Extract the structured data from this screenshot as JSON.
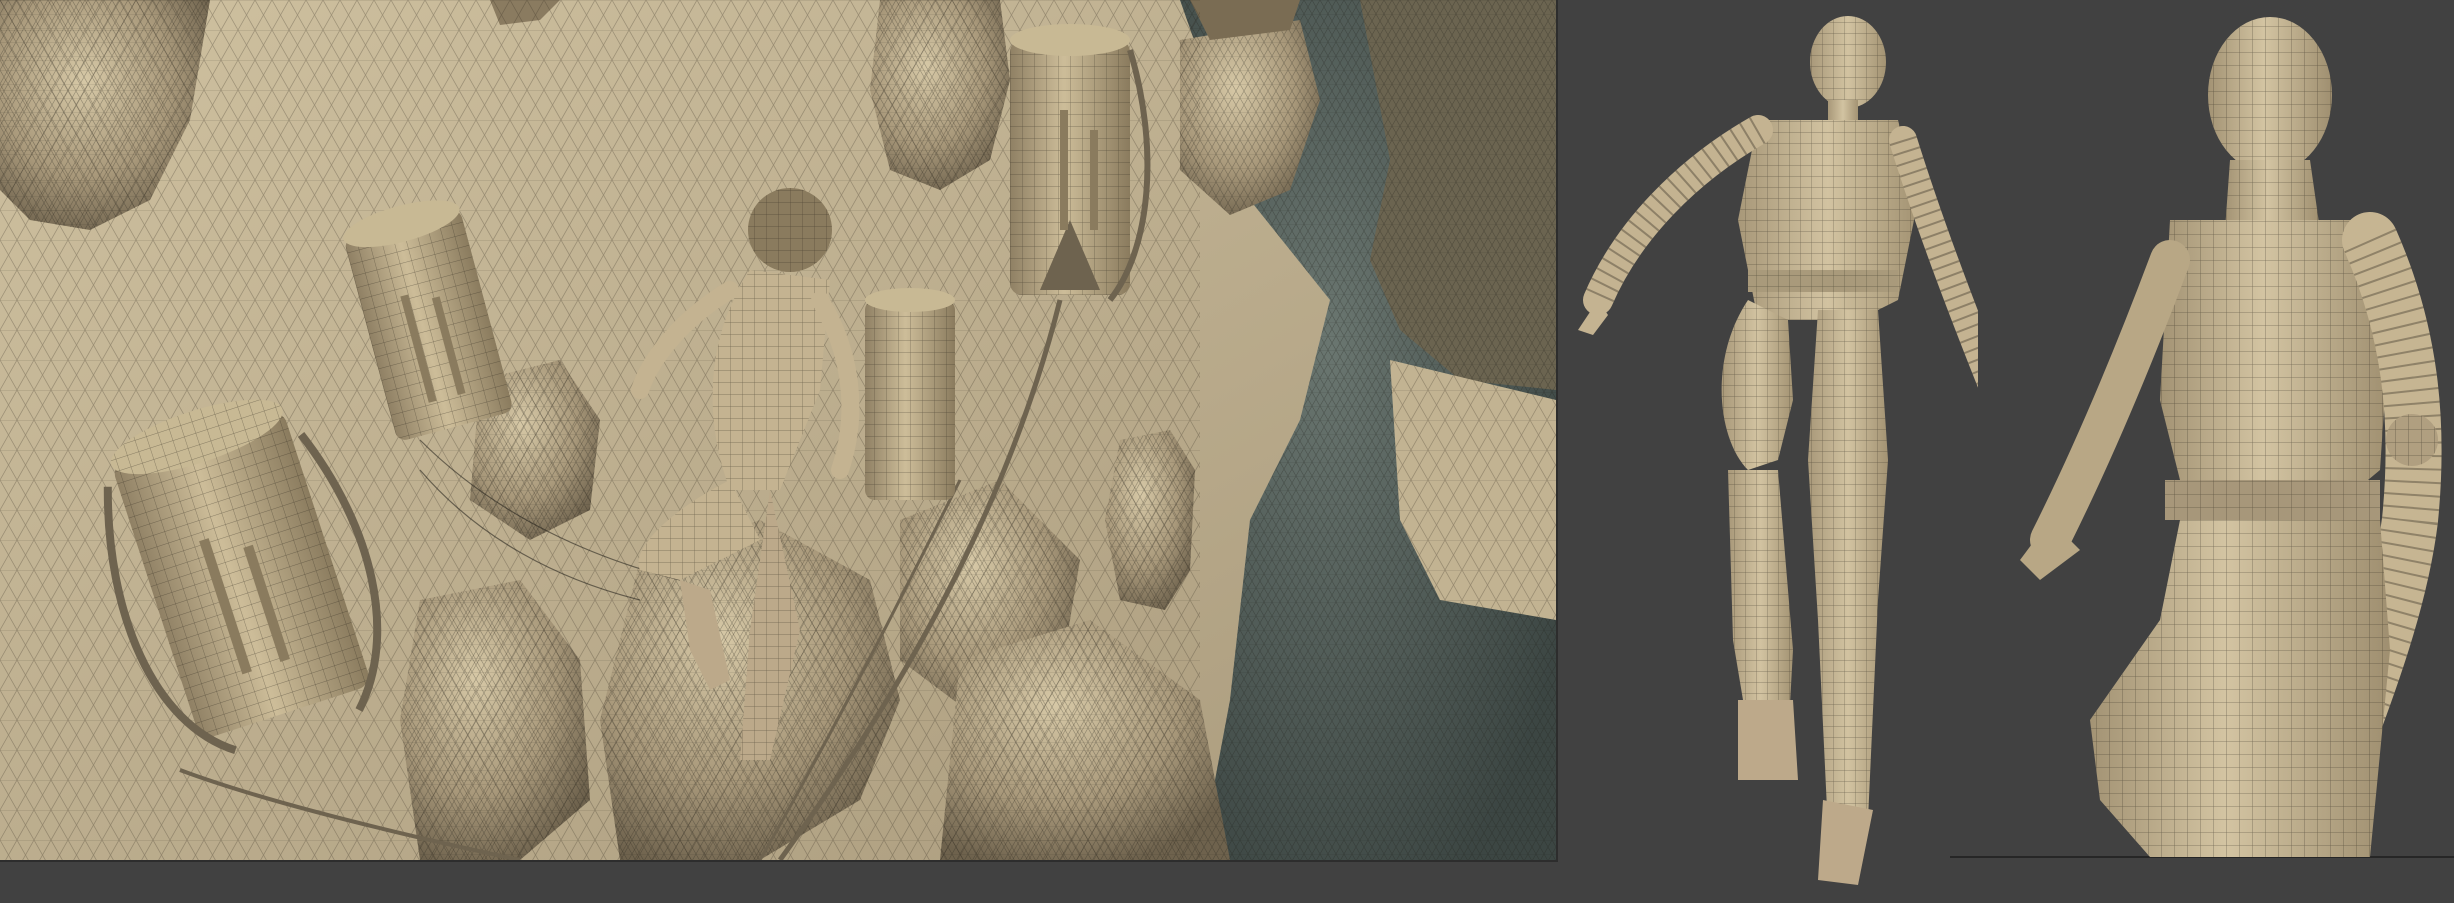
{
  "image": {
    "panels": [
      {
        "name": "cliff-scene-wireframe",
        "background": "#b7a98c"
      },
      {
        "name": "character-full-body-wireframe",
        "background": "#414141"
      },
      {
        "name": "character-closeup-wireframe",
        "background": "#414141"
      }
    ],
    "colors": {
      "viewport_gray": "#414141",
      "clay": "#c4b391",
      "clay_light": "#d8caa8",
      "clay_dark": "#8c7d62",
      "shadow_teal": "#4f5c59",
      "wire": "#2a261c"
    }
  }
}
